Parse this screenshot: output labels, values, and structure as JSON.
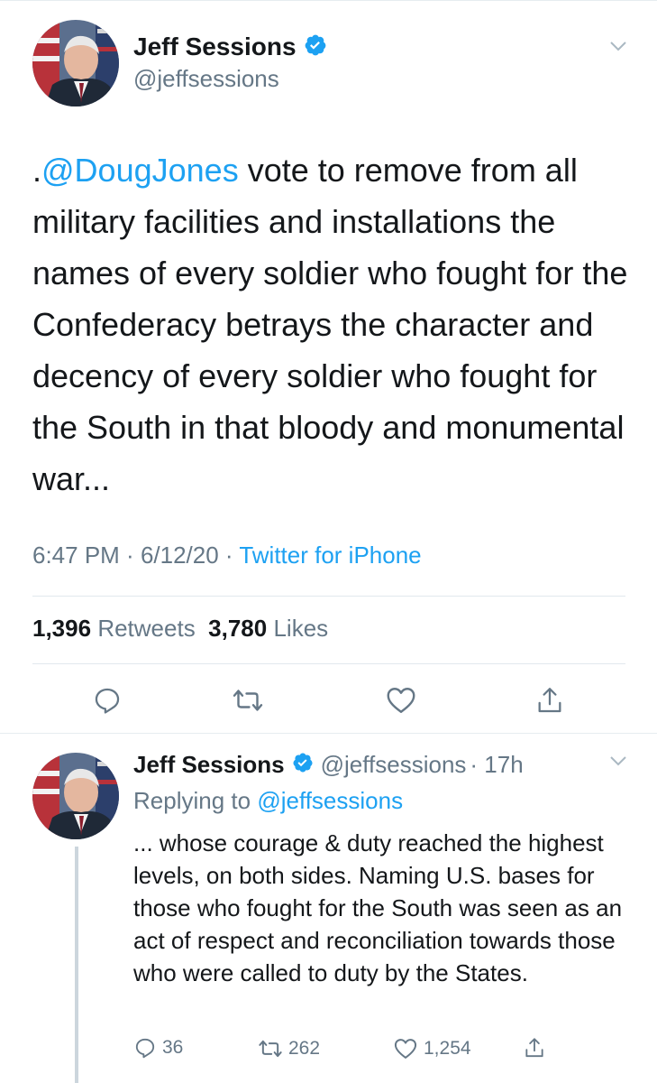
{
  "main_tweet": {
    "author_name": "Jeff Sessions",
    "author_handle": "@jeffsessions",
    "text_prefix": ".",
    "mention": "@DougJones",
    "text_body": " vote to remove from all military facilities and installations the names of every soldier who fought for the Confederacy betrays the character and decency of every soldier who fought for the South in that bloody and monumental war...",
    "time": "6:47 PM",
    "separator": " · ",
    "date": "6/12/20",
    "source": "Twitter for iPhone",
    "retweets_count": "1,396",
    "retweets_label": "Retweets",
    "likes_count": "3,780",
    "likes_label": "Likes",
    "actions": [
      "reply-icon",
      "retweet-icon",
      "like-icon",
      "share-icon"
    ]
  },
  "reply_tweet": {
    "author_name": "Jeff Sessions",
    "author_handle": "@jeffsessions",
    "timestamp": "· 17h",
    "replying_label": "Replying to",
    "replying_to": "@jeffsessions",
    "text": "... whose courage & duty reached the highest levels, on both sides. Naming U.S. bases for those who fought for the South was seen as an act of respect and reconciliation towards those who were called to duty by the States.",
    "reply_count": "36",
    "retweet_count": "262",
    "like_count": "1,254"
  },
  "colors": {
    "accent": "#1da1f2",
    "text_primary": "#14171a",
    "text_secondary": "#657786",
    "divider": "#e1e8ed"
  }
}
